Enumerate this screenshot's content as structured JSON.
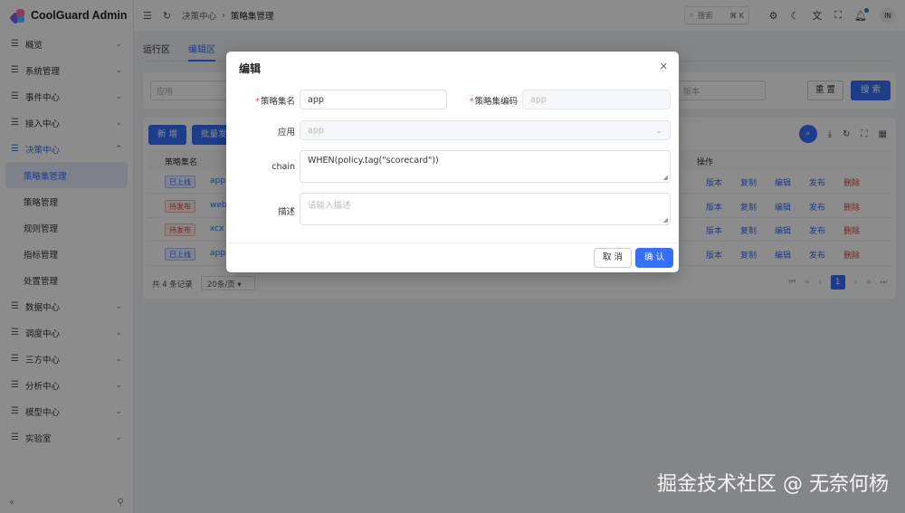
{
  "app": {
    "title": "CoolGuard Admin"
  },
  "sidebar": {
    "items": [
      {
        "label": "概览",
        "open": false
      },
      {
        "label": "系统管理",
        "open": false
      },
      {
        "label": "事件中心",
        "open": false
      },
      {
        "label": "接入中心",
        "open": false
      },
      {
        "label": "决策中心",
        "open": true,
        "children": [
          "策略集管理",
          "策略管理",
          "规则管理",
          "指标管理",
          "处置管理"
        ]
      },
      {
        "label": "数据中心",
        "open": false
      },
      {
        "label": "调度中心",
        "open": false
      },
      {
        "label": "三方中心",
        "open": false
      },
      {
        "label": "分析中心",
        "open": false
      },
      {
        "label": "模型中心",
        "open": false
      },
      {
        "label": "实验室",
        "open": false
      }
    ],
    "active_child": "策略集管理",
    "collapse_symbol": "«",
    "pin_symbol": "⚲"
  },
  "header": {
    "breadcrumb": [
      "决策中心",
      "策略集管理"
    ],
    "search_label": "搜索",
    "search_shortcut": "⌘ K",
    "avatar": "IN"
  },
  "main": {
    "tabs": [
      "运行区",
      "编辑区"
    ],
    "active_tab": "编辑区",
    "filter": {
      "app_placeholder": "应用",
      "version_placeholder": "版本",
      "reset_label": "重 置",
      "search_label": "搜 索"
    },
    "toolbar": {
      "add_label": "新 增",
      "batch_label": "批量发布"
    },
    "columns": {
      "name": "策略集名",
      "actions": "操作"
    },
    "rows": [
      {
        "status": "已上线",
        "status_type": "on",
        "name": "app"
      },
      {
        "status": "待发布",
        "status_type": "wait",
        "name": "web"
      },
      {
        "status": "待发布",
        "status_type": "wait",
        "name": "xcx"
      },
      {
        "status": "已上线",
        "status_type": "on",
        "name": "app"
      }
    ],
    "row_actions": [
      "版本",
      "复制",
      "编辑",
      "发布",
      "删除"
    ],
    "pagination": {
      "total": "共 4 条记录",
      "page_size": "20条/页",
      "current_page": "1"
    }
  },
  "modal": {
    "title": "编辑",
    "fields": {
      "name_label": "策略集名",
      "name_value": "app",
      "code_label": "策略集编码",
      "code_value": "app",
      "app_label": "应用",
      "app_value": "app",
      "chain_label": "chain",
      "chain_value": "WHEN(policy.tag(\"scorecard\"))",
      "desc_label": "描述",
      "desc_placeholder": "请输入描述"
    },
    "cancel_label": "取 消",
    "ok_label": "确 认"
  },
  "watermark": "掘金技术社区 @ 无奈何杨",
  "colors": {
    "primary": "#3370ff",
    "danger": "#e0463d"
  }
}
